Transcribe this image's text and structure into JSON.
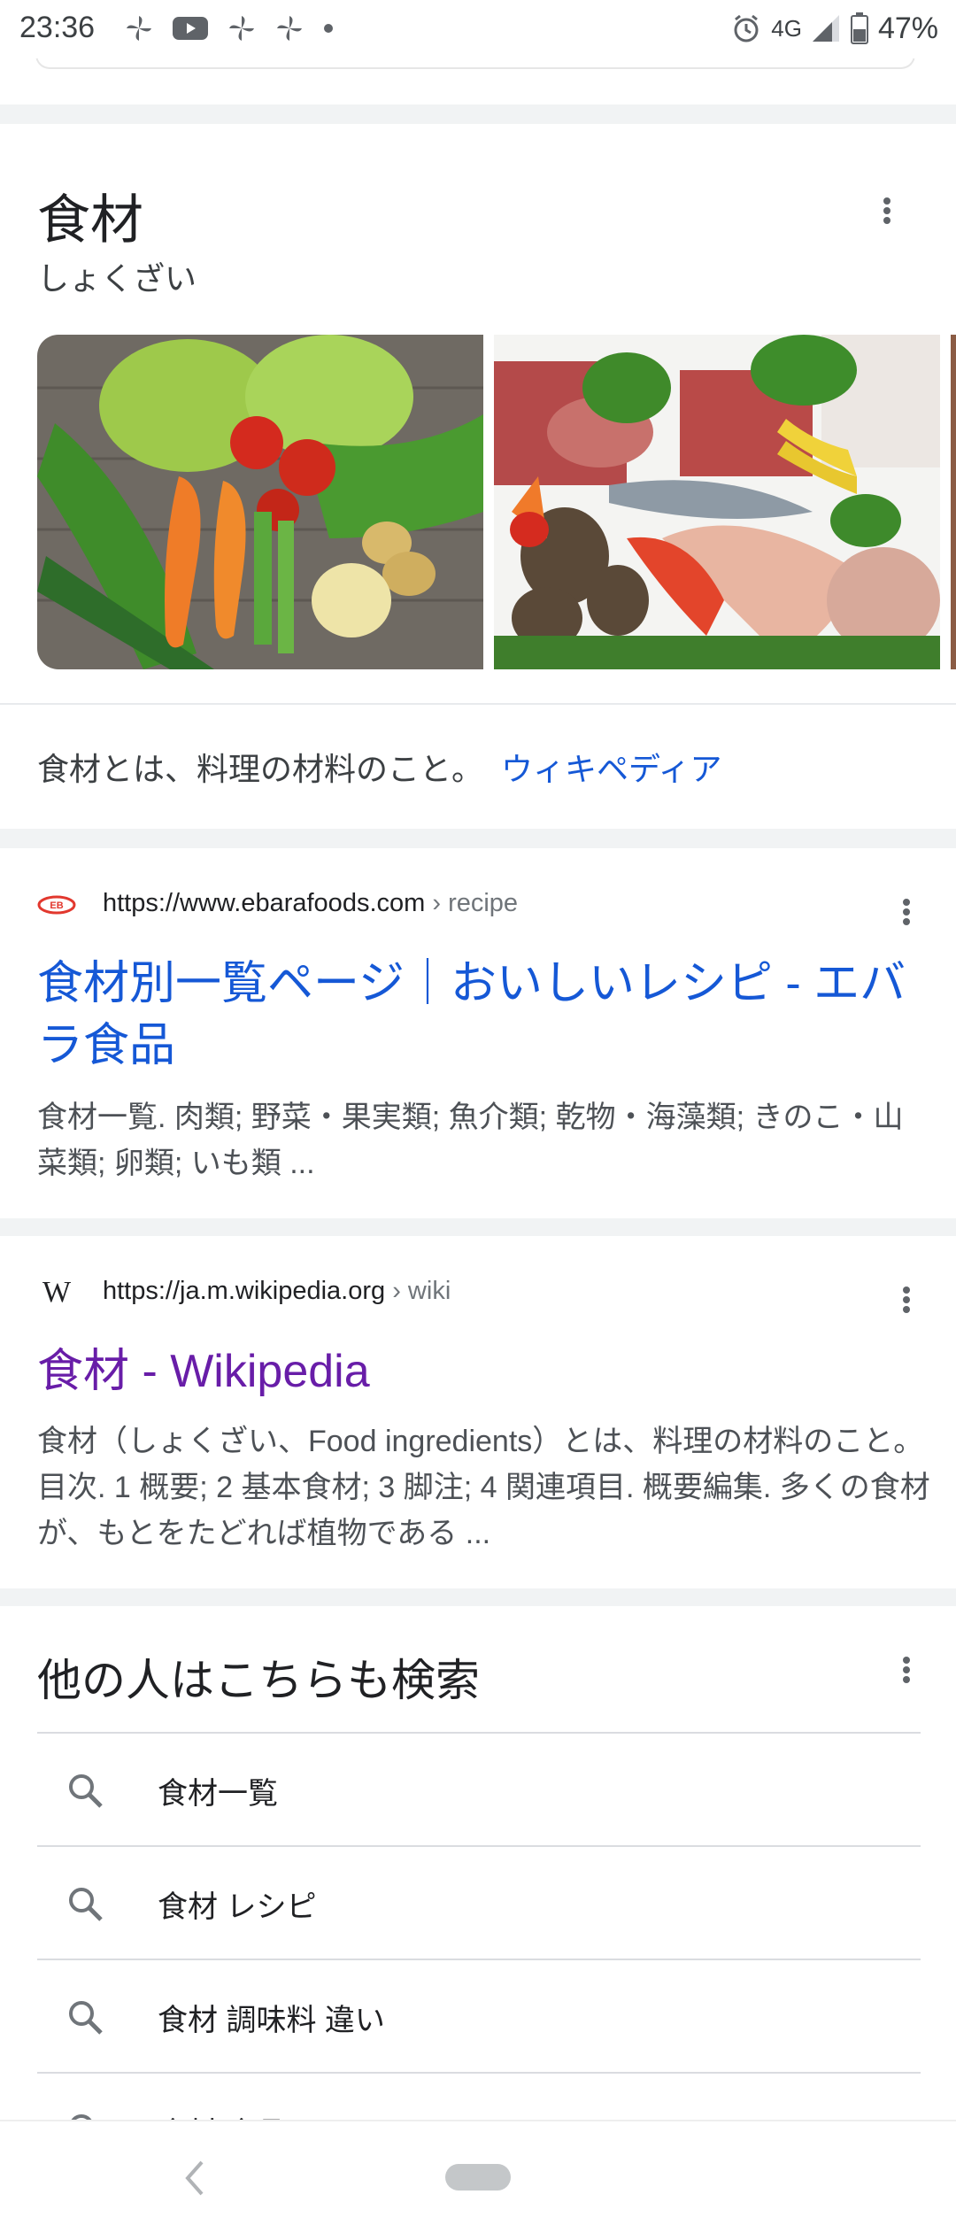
{
  "status_bar": {
    "time": "23:36",
    "left_icons": [
      "pinwheel-icon",
      "youtube-icon",
      "pinwheel-icon",
      "pinwheel-icon",
      "dot-icon"
    ],
    "network": "4G",
    "battery": "47%",
    "right_icons": [
      "alarm-icon",
      "signal-icon",
      "battery-icon"
    ]
  },
  "knowledge_panel": {
    "title": "食材",
    "reading": "しょくざい",
    "images": [
      "vegetables-image",
      "meat-and-seafood-image"
    ],
    "description": "食材とは、料理の材料のこと。",
    "source_link": "ウィキペディア"
  },
  "results": [
    {
      "favicon": "ebara-logo-icon",
      "url": "https://www.ebarafoods.com",
      "crumb": "› recipe",
      "title": "食材別一覧ページ｜おいしいレシピ - エバラ食品",
      "snippet": "食材一覧. 肉類; 野菜・果実類; 魚介類; 乾物・海藻類; きのこ・山菜類; 卵類; いも類 ..."
    },
    {
      "favicon": "wikipedia-icon",
      "url": "https://ja.m.wikipedia.org",
      "crumb": "› wiki",
      "title": "食材 - Wikipedia",
      "snippet": "食材（しょくざい、Food ingredients）とは、料理の材料のこと。 目次. 1 概要; 2 基本食材; 3 脚注; 4 関連項目. 概要編集. 多くの食材が、もとをたどれば植物である ..."
    }
  ],
  "related": {
    "heading": "他の人はこちらも検索",
    "items": [
      "食材一覧",
      "食材 レシピ",
      "食材 調味料 違い",
      "食材 食品"
    ]
  },
  "colors": {
    "link_blue": "#1558d6",
    "visited_purple": "#681da8",
    "snippet_gray": "#4d5156",
    "divider": "#dadce0"
  }
}
